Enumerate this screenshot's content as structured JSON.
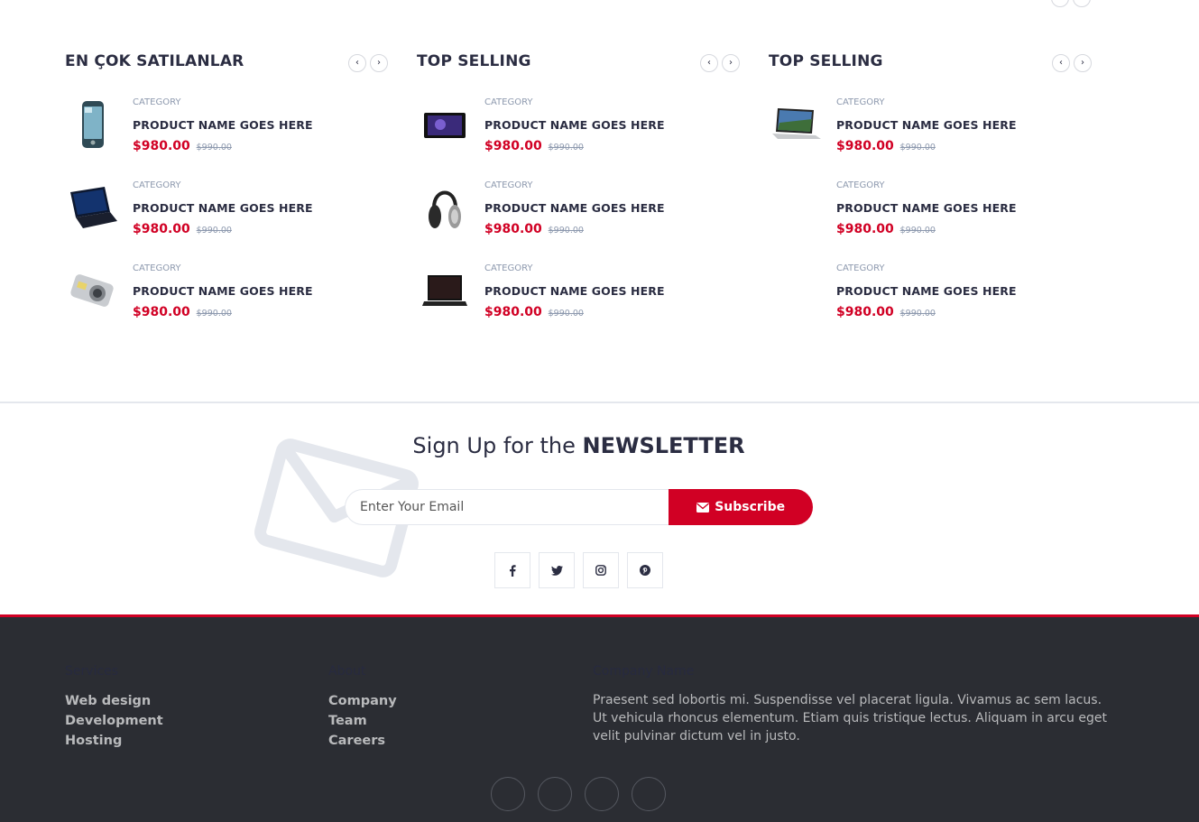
{
  "top_nav": {
    "prev_icon": "chevron-left-icon",
    "next_icon": "chevron-right-icon"
  },
  "widgets": [
    {
      "title": "EN ÇOK SATILANLAR",
      "products": [
        {
          "image": "smartphone-image",
          "category": "CATEGORY",
          "name": "PRODUCT NAME GOES HERE",
          "price": "$980.00",
          "old_price": "$990.00"
        },
        {
          "image": "laptop-image",
          "category": "CATEGORY",
          "name": "PRODUCT NAME GOES HERE",
          "price": "$980.00",
          "old_price": "$990.00"
        },
        {
          "image": "camera-image",
          "category": "CATEGORY",
          "name": "PRODUCT NAME GOES HERE",
          "price": "$980.00",
          "old_price": "$990.00"
        }
      ]
    },
    {
      "title": "TOP SELLING",
      "products": [
        {
          "image": "tablet-image",
          "category": "CATEGORY",
          "name": "PRODUCT NAME GOES HERE",
          "price": "$980.00",
          "old_price": "$990.00"
        },
        {
          "image": "headphones-image",
          "category": "CATEGORY",
          "name": "PRODUCT NAME GOES HERE",
          "price": "$980.00",
          "old_price": "$990.00"
        },
        {
          "image": "laptop-image",
          "category": "CATEGORY",
          "name": "PRODUCT NAME GOES HERE",
          "price": "$980.00",
          "old_price": "$990.00"
        }
      ]
    },
    {
      "title": "TOP SELLING",
      "products": [
        {
          "image": "laptop-image",
          "category": "CATEGORY",
          "name": "PRODUCT NAME GOES HERE",
          "price": "$980.00",
          "old_price": "$990.00"
        },
        {
          "image": "",
          "category": "CATEGORY",
          "name": "PRODUCT NAME GOES HERE",
          "price": "$980.00",
          "old_price": "$990.00"
        },
        {
          "image": "",
          "category": "CATEGORY",
          "name": "PRODUCT NAME GOES HERE",
          "price": "$980.00",
          "old_price": "$990.00"
        }
      ]
    }
  ],
  "newsletter": {
    "title_prefix": "Sign Up for the ",
    "title_strong": "NEWSLETTER",
    "email_placeholder": "Enter Your Email",
    "subscribe_label": "Subscribe",
    "subscribe_icon": "envelope-icon",
    "social": [
      {
        "icon": "facebook-icon",
        "glyph": "f"
      },
      {
        "icon": "twitter-icon",
        "glyph": "t"
      },
      {
        "icon": "instagram-icon",
        "glyph": "◎"
      },
      {
        "icon": "pinterest-icon",
        "glyph": "p"
      }
    ]
  },
  "footer": {
    "col1": {
      "heading": "Services",
      "links": [
        "Web design",
        "Development",
        "Hosting"
      ]
    },
    "col2": {
      "heading": "About",
      "links": [
        "Company",
        "Team",
        "Careers"
      ]
    },
    "col3": {
      "heading": "Company Name",
      "text": "Praesent sed lobortis mi. Suspendisse vel placerat ligula. Vivamus ac sem lacus. Ut vehicula rhoncus elementum. Etiam quis tristique lectus. Aliquam in arcu eget velit pulvinar dictum vel in justo."
    },
    "social_circles": [
      "circle-social-1",
      "circle-social-2",
      "circle-social-3",
      "circle-social-4"
    ],
    "accent_color": "#d10024",
    "background_color": "#2b2d33"
  },
  "colors": {
    "accent": "#d10024",
    "text": "#2b2d42",
    "muted": "#8d99ae"
  }
}
